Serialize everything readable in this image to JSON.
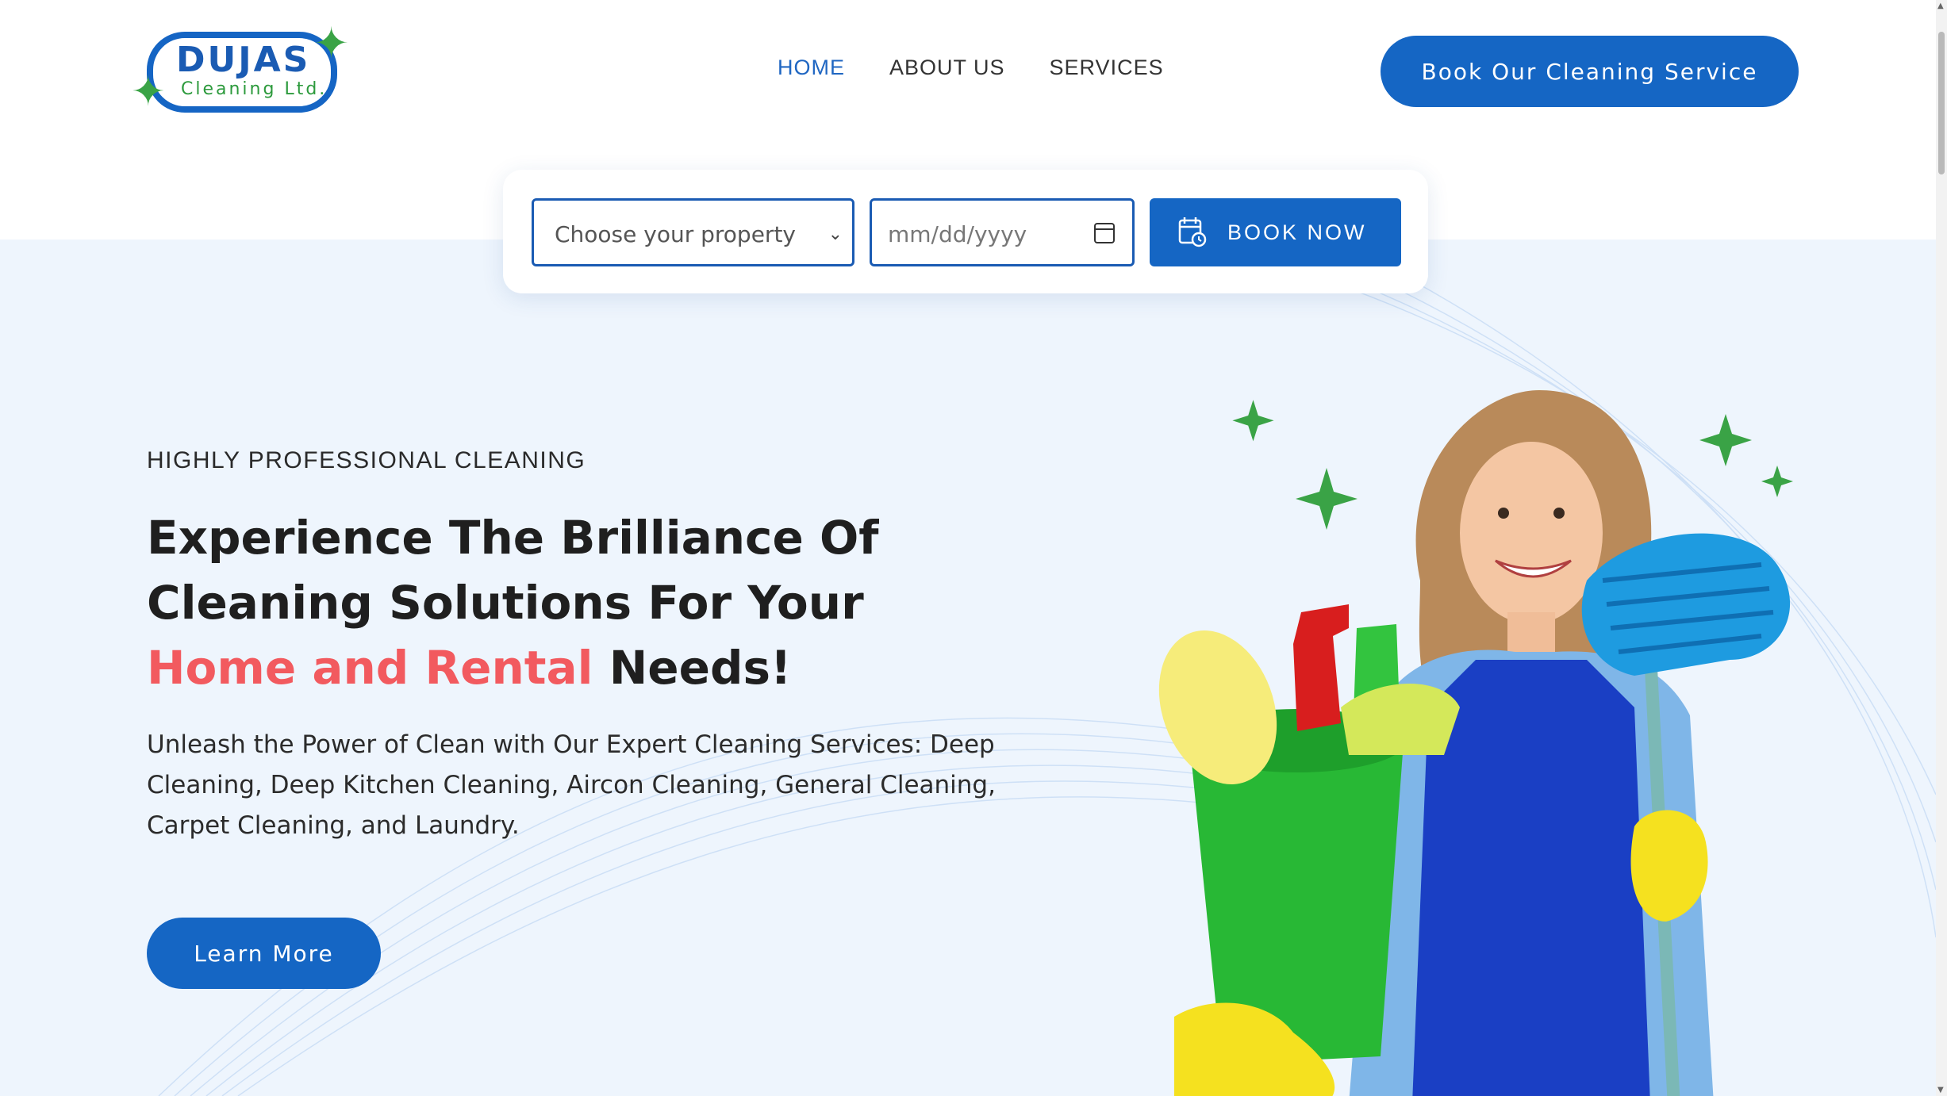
{
  "brand": {
    "name": "DUJAS",
    "tagline": "Cleaning Ltd.",
    "colors": {
      "primary": "#1566c4",
      "accent_green": "#3aa346",
      "accent_red": "#f25a5f",
      "hero_bg": "#eef5fd"
    }
  },
  "nav": {
    "items": [
      {
        "label": "HOME",
        "active": true
      },
      {
        "label": "ABOUT US",
        "active": false
      },
      {
        "label": "SERVICES",
        "active": false
      }
    ],
    "cta_label": "Book Our Cleaning Service"
  },
  "booking": {
    "property_placeholder": "Choose your property",
    "date_placeholder": "mm/dd/yyyy",
    "button_label": "BOOK NOW",
    "button_icon": "calendar-clock-icon"
  },
  "hero": {
    "eyebrow": "HIGHLY PROFESSIONAL CLEANING",
    "headline_line1": "Experience The Brilliance Of",
    "headline_line2": "Cleaning Solutions For Your",
    "headline_accent": "Home and Rental",
    "headline_end": " Needs!",
    "description": "Unleash the Power of Clean with Our Expert Cleaning Services: Deep Cleaning, Deep Kitchen Cleaning, Aircon Cleaning, General Cleaning, Carpet Cleaning, and Laundry.",
    "button_label": "Learn More",
    "image": "woman-with-cleaning-supplies"
  }
}
